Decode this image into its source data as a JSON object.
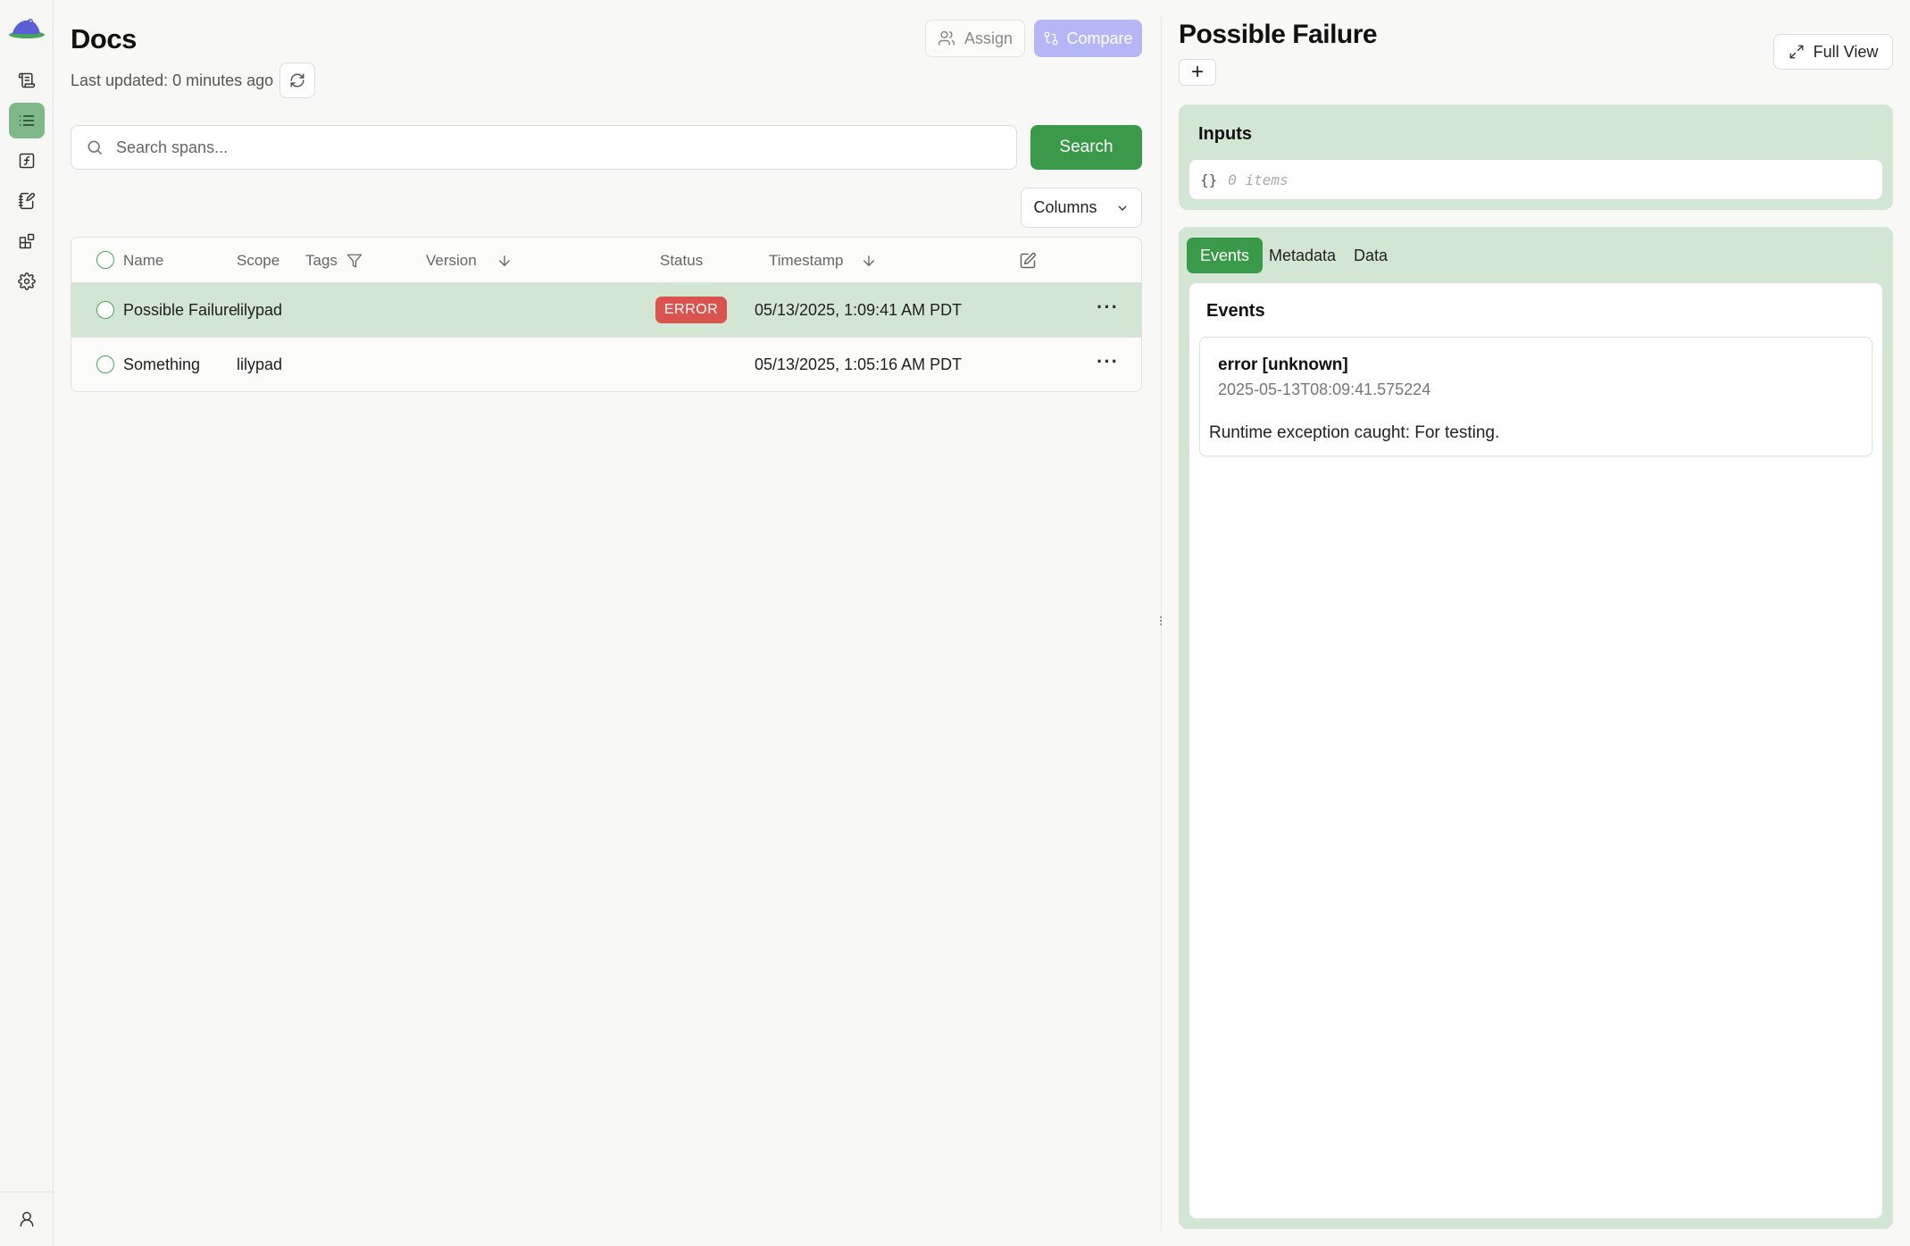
{
  "sidebar": {
    "items": [
      {
        "icon": "scroll-icon"
      },
      {
        "icon": "list-icon",
        "active": true
      },
      {
        "icon": "function-icon"
      },
      {
        "icon": "notebook-pen-icon"
      },
      {
        "icon": "blocks-icon"
      },
      {
        "icon": "gear-icon"
      }
    ],
    "bottom_icon": "user-icon"
  },
  "header": {
    "title": "Docs",
    "updated": "Last updated: 0 minutes ago",
    "assign_label": "Assign",
    "compare_label": "Compare"
  },
  "search": {
    "placeholder": "Search spans...",
    "button_label": "Search"
  },
  "columns_label": "Columns",
  "table": {
    "headers": {
      "name": "Name",
      "scope": "Scope",
      "tags": "Tags",
      "version": "Version",
      "status": "Status",
      "timestamp": "Timestamp"
    },
    "rows": [
      {
        "name": "Possible Failure",
        "scope": "lilypad",
        "status": "ERROR",
        "timestamp": "05/13/2025, 1:09:41 AM PDT",
        "selected": true
      },
      {
        "name": "Something",
        "scope": "lilypad",
        "status": "",
        "timestamp": "05/13/2025, 1:05:16 AM PDT",
        "selected": false
      }
    ],
    "more_label": "···"
  },
  "detail": {
    "title": "Possible Failure",
    "add_label": "+",
    "full_view_label": "Full View",
    "inputs": {
      "title": "Inputs",
      "brace": "{}",
      "count": "0 items"
    },
    "tabs": [
      {
        "label": "Events",
        "active": true
      },
      {
        "label": "Metadata",
        "active": false
      },
      {
        "label": "Data",
        "active": false
      }
    ],
    "events": {
      "title": "Events",
      "items": [
        {
          "name": "error [unknown]",
          "timestamp": "2025-05-13T08:09:41.575224",
          "message": "Runtime exception caught: For testing."
        }
      ]
    }
  },
  "colors": {
    "accent_green": "#3b9a4a",
    "selected_row": "#d3e6d4",
    "error_badge": "#d9534f",
    "compare_button": "#b5b6f5"
  }
}
